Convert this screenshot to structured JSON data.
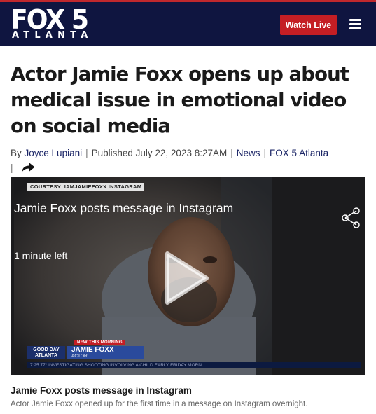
{
  "header": {
    "logo_main": "FOX 5",
    "logo_sub": "ATLANTA",
    "watch_live_label": "Watch Live",
    "menu_icon": "hamburger-menu-icon",
    "colors": {
      "background": "#0f1540",
      "accent": "#c41e24"
    }
  },
  "article": {
    "headline": "Actor Jamie Foxx opens up about medical issue in emotional video on social media",
    "byline": {
      "by_prefix": "By",
      "author": "Joyce Lupiani",
      "separator": "|",
      "published": "Published July 22, 2023 8:27AM",
      "category": "News",
      "source": "FOX 5 Atlanta",
      "share_icon": "share-arrow-icon"
    }
  },
  "video": {
    "courtesy": "COURTESY: IAMJAMIEFOXX INSTAGRAM",
    "title": "Jamie Foxx posts message in Instagram",
    "time_left": "1 minute left",
    "share_icon": "share-nodes-icon",
    "play_icon": "play-icon",
    "lower_third": {
      "tag": "NEW THIS MORNING",
      "show_line1": "GOOD DAY",
      "show_line2": "ATLANTA",
      "name": "JAMIE FOXX",
      "role": "ACTOR"
    },
    "ticker": "7:25   77°   INVESTIGATING SHOOTING INVOLVING A CHILD EARLY FRIDAY MORN"
  },
  "caption": {
    "title": "Jamie Foxx posts message in Instagram",
    "description": "Actor Jamie Foxx opened up for the first time in a message on Instagram overnight."
  }
}
